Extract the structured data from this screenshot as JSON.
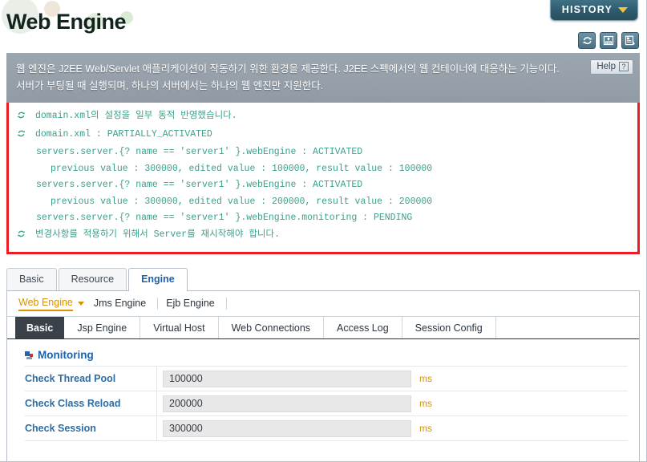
{
  "header": {
    "title": "Web Engine",
    "history_label": "HISTORY",
    "tool_icons": [
      {
        "name": "refresh-icon",
        "title": "Refresh"
      },
      {
        "name": "export-xml-icon",
        "title": "XML"
      },
      {
        "name": "export-report-icon",
        "title": "Report"
      }
    ]
  },
  "description": {
    "text": "웹 엔진은 J2EE Web/Servlet 애플리케이션이 작동하기 위한 환경을 제공한다. J2EE 스펙에서의 웹 컨테이너에 대응하는 기능이다. 서버가 부팅될 때 실행되며, 하나의 서버에서는 하나의 웹 엔진만 지원한다.",
    "help_label": "Help",
    "help_mark": "?"
  },
  "message_box": {
    "border_color": "#ec1c24",
    "text_color": "#3aa08c",
    "lines": [
      {
        "icon": true,
        "indent": 0,
        "text": "domain.xml의 설정을 일부 동적 반영했습니다."
      },
      {
        "icon": true,
        "indent": 0,
        "text": "domain.xml : PARTIALLY_ACTIVATED"
      },
      {
        "icon": false,
        "indent": 1,
        "text": "servers.server.{? name == 'server1' }.webEngine : ACTIVATED"
      },
      {
        "icon": false,
        "indent": 2,
        "text": "previous value : 300000, edited value : 100000, result value : 100000"
      },
      {
        "icon": false,
        "indent": 1,
        "text": "servers.server.{? name == 'server1' }.webEngine : ACTIVATED"
      },
      {
        "icon": false,
        "indent": 2,
        "text": "previous value : 300000, edited value : 200000, result value : 200000"
      },
      {
        "icon": false,
        "indent": 1,
        "text": "servers.server.{? name == 'server1' }.webEngine.monitoring : PENDING"
      },
      {
        "icon": true,
        "indent": 0,
        "text": "변경사항를 적용하기 위해서 Server를 재시작해야 합니다."
      }
    ]
  },
  "tabs_level1": [
    {
      "label": "Basic",
      "active": false
    },
    {
      "label": "Resource",
      "active": false
    },
    {
      "label": "Engine",
      "active": true
    }
  ],
  "tabs_level2": [
    {
      "label": "Web Engine",
      "active": true,
      "has_caret": true
    },
    {
      "label": "Jms Engine",
      "active": false,
      "has_caret": false
    },
    {
      "label": "Ejb Engine",
      "active": false,
      "has_caret": false
    }
  ],
  "tabs_level3": [
    {
      "label": "Basic",
      "active": true
    },
    {
      "label": "Jsp Engine",
      "active": false
    },
    {
      "label": "Virtual Host",
      "active": false
    },
    {
      "label": "Web Connections",
      "active": false
    },
    {
      "label": "Access Log",
      "active": false
    },
    {
      "label": "Session Config",
      "active": false
    }
  ],
  "section": {
    "title": "Monitoring",
    "rows": [
      {
        "label": "Check Thread Pool",
        "value": "100000",
        "unit": "ms"
      },
      {
        "label": "Check Class Reload",
        "value": "200000",
        "unit": "ms"
      },
      {
        "label": "Check Session",
        "value": "300000",
        "unit": "ms"
      }
    ]
  },
  "colors": {
    "accent_orange": "#d99200",
    "accent_blue": "#1f62ab",
    "alert_red": "#ec1c24",
    "message_teal": "#3aa08c",
    "history_teal": "#2e5c6e"
  }
}
